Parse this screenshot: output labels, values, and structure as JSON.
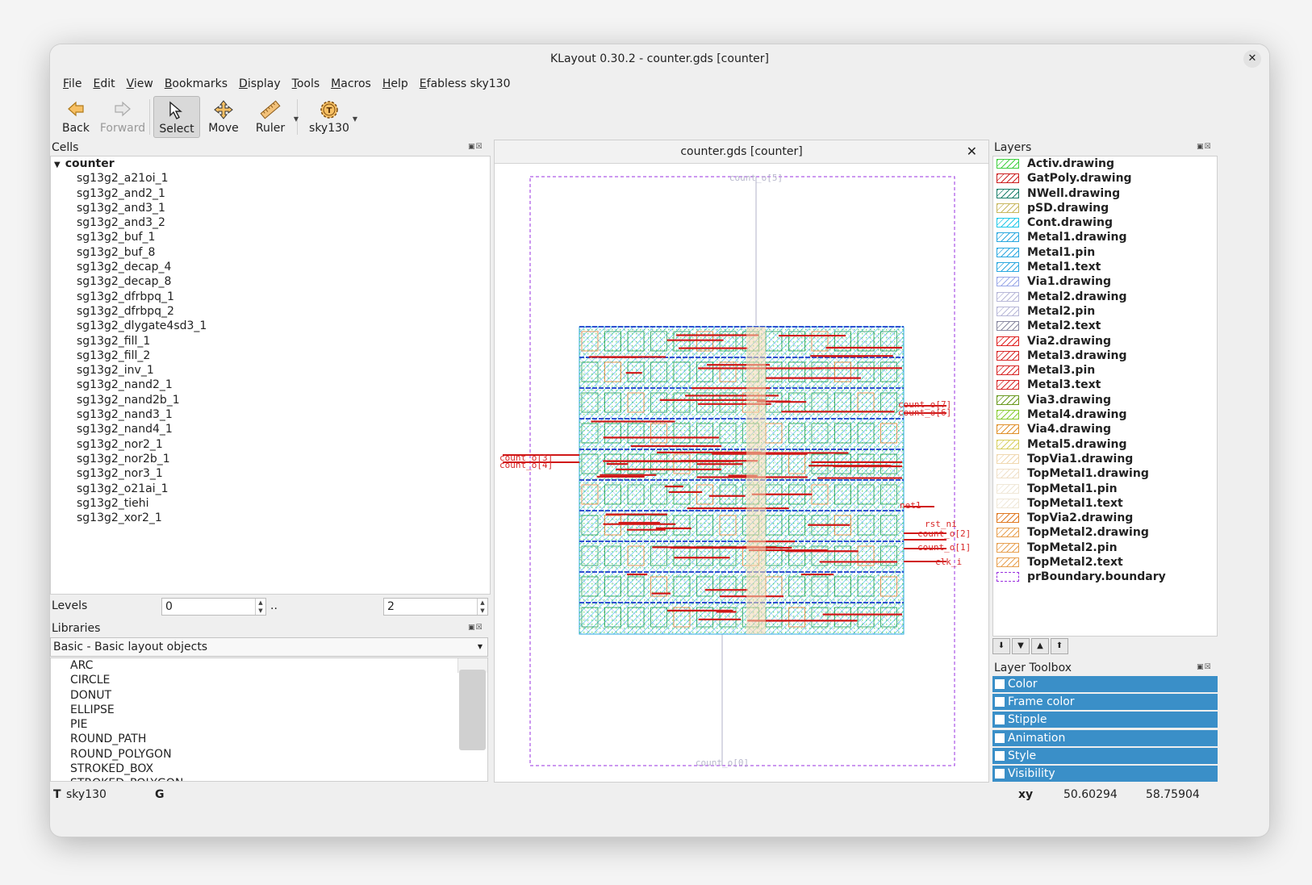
{
  "window": {
    "title": "KLayout 0.30.2 - counter.gds [counter]"
  },
  "menu": [
    "File",
    "Edit",
    "View",
    "Bookmarks",
    "Display",
    "Tools",
    "Macros",
    "Help",
    "Efabless sky130"
  ],
  "toolbar": {
    "back": "Back",
    "forward": "Forward",
    "select": "Select",
    "move": "Move",
    "ruler": "Ruler",
    "tech": "sky130"
  },
  "cells": {
    "title": "Cells",
    "root": "counter",
    "items": [
      "sg13g2_a21oi_1",
      "sg13g2_and2_1",
      "sg13g2_and3_1",
      "sg13g2_and3_2",
      "sg13g2_buf_1",
      "sg13g2_buf_8",
      "sg13g2_decap_4",
      "sg13g2_decap_8",
      "sg13g2_dfrbpq_1",
      "sg13g2_dfrbpq_2",
      "sg13g2_dlygate4sd3_1",
      "sg13g2_fill_1",
      "sg13g2_fill_2",
      "sg13g2_inv_1",
      "sg13g2_nand2_1",
      "sg13g2_nand2b_1",
      "sg13g2_nand3_1",
      "sg13g2_nand4_1",
      "sg13g2_nor2_1",
      "sg13g2_nor2b_1",
      "sg13g2_nor3_1",
      "sg13g2_o21ai_1",
      "sg13g2_tiehi",
      "sg13g2_xor2_1"
    ]
  },
  "levels": {
    "label": "Levels",
    "from": "0",
    "sep": "..",
    "to": "2"
  },
  "libraries": {
    "title": "Libraries",
    "selected": "Basic - Basic layout objects",
    "items": [
      "ARC",
      "CIRCLE",
      "DONUT",
      "ELLIPSE",
      "PIE",
      "ROUND_PATH",
      "ROUND_POLYGON",
      "STROKED_BOX",
      "STROKED_POLYGON"
    ]
  },
  "canvas": {
    "tab_title": "counter.gds [counter]",
    "labels": {
      "top": "count_o[5]",
      "bottom": "count_o[0]",
      "l1": "count_o[3]",
      "l2": "count_o[4]",
      "r7": "count_o[7]",
      "r6": "count_o[6]",
      "net1": "net1",
      "rst": "rst_ni",
      "r2": "count_o[2]",
      "r1": "count_o[1]",
      "clk": "clk_i"
    }
  },
  "layers": {
    "title": "Layers",
    "items": [
      {
        "name": "Activ.drawing",
        "color": "#3fcf3f"
      },
      {
        "name": "GatPoly.drawing",
        "color": "#cc2020"
      },
      {
        "name": "NWell.drawing",
        "color": "#1a7f6a"
      },
      {
        "name": "pSD.drawing",
        "color": "#c8b860"
      },
      {
        "name": "Cont.drawing",
        "color": "#20c8e8"
      },
      {
        "name": "Metal1.drawing",
        "color": "#2aa8e0"
      },
      {
        "name": "Metal1.pin",
        "color": "#2aa8e0"
      },
      {
        "name": "Metal1.text",
        "color": "#2aa8e0"
      },
      {
        "name": "Via1.drawing",
        "color": "#9aa8e8"
      },
      {
        "name": "Metal2.drawing",
        "color": "#b8b8d8"
      },
      {
        "name": "Metal2.pin",
        "color": "#b8b8d8"
      },
      {
        "name": "Metal2.text",
        "color": "#8888a0"
      },
      {
        "name": "Via2.drawing",
        "color": "#e02020"
      },
      {
        "name": "Metal3.drawing",
        "color": "#d82828"
      },
      {
        "name": "Metal3.pin",
        "color": "#d82828"
      },
      {
        "name": "Metal3.text",
        "color": "#d82828"
      },
      {
        "name": "Via3.drawing",
        "color": "#6a9a20"
      },
      {
        "name": "Metal4.drawing",
        "color": "#88cc30"
      },
      {
        "name": "Via4.drawing",
        "color": "#e0902a"
      },
      {
        "name": "Metal5.drawing",
        "color": "#d8d060"
      },
      {
        "name": "TopVia1.drawing",
        "color": "#f0d8b0"
      },
      {
        "name": "TopMetal1.drawing",
        "color": "#f0e0c8"
      },
      {
        "name": "TopMetal1.pin",
        "color": "#f0e8d8"
      },
      {
        "name": "TopMetal1.text",
        "color": "#f0e8d8"
      },
      {
        "name": "TopVia2.drawing",
        "color": "#e07820"
      },
      {
        "name": "TopMetal2.drawing",
        "color": "#e8a050"
      },
      {
        "name": "TopMetal2.pin",
        "color": "#e8a050"
      },
      {
        "name": "TopMetal2.text",
        "color": "#e8a050"
      },
      {
        "name": "prBoundary.boundary",
        "color": "#9a30e0"
      }
    ]
  },
  "layer_toolbox": {
    "title": "Layer Toolbox",
    "items": [
      "Color",
      "Frame color",
      "Stipple",
      "Animation",
      "Style",
      "Visibility"
    ]
  },
  "status": {
    "tech_prefix": "T",
    "tech": "sky130",
    "grid": "G",
    "xy_label": "xy",
    "x": "50.60294",
    "y": "58.75904"
  }
}
